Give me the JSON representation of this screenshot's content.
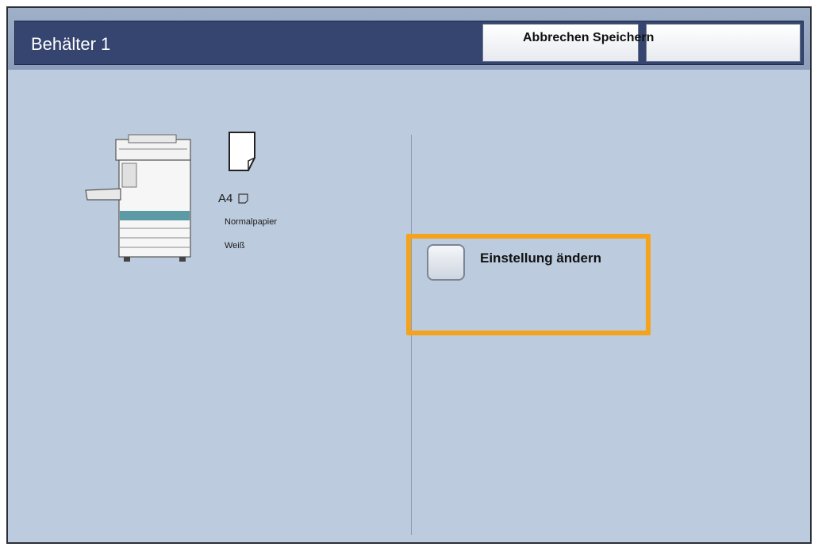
{
  "header": {
    "title": "Behälter 1",
    "cancel_label": "Abbrechen",
    "save_label": "Speichern",
    "combined_label": "Abbrechen Speichern"
  },
  "tray": {
    "paper_size": "A4",
    "paper_type": "Normalpapier",
    "paper_color": "Weiß"
  },
  "actions": {
    "change_settings_label": "Einstellung ändern"
  },
  "colors": {
    "background": "#bccbdd",
    "titlebar": "#35456f",
    "highlight": "#f5a31c"
  },
  "icons": {
    "printer": "printer-icon",
    "paper": "paper-sheet-icon",
    "orientation": "landscape-orientation-icon",
    "checkbox": "checkbox-icon"
  }
}
